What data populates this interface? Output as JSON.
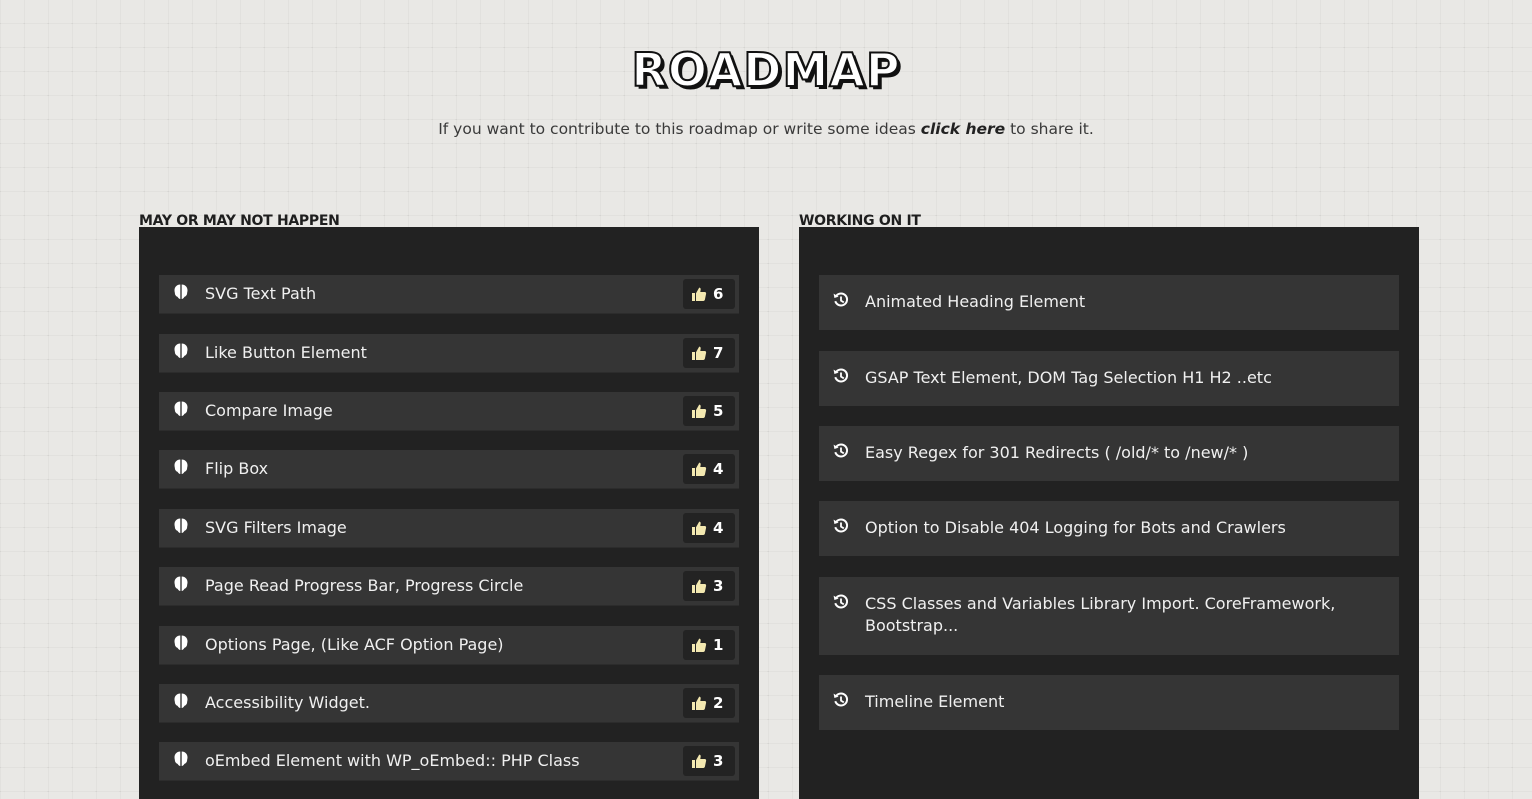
{
  "header": {
    "title": "ROADMAP",
    "subtitle_before": "If you want to contribute to this roadmap or write some ideas ",
    "subtitle_link": "click here",
    "subtitle_after": " to share it."
  },
  "columns": {
    "maybe": {
      "label": "MAY OR MAY NOT HAPPEN",
      "items": [
        {
          "label": "SVG Text Path",
          "votes": "6"
        },
        {
          "label": "Like Button Element",
          "votes": "7"
        },
        {
          "label": "Compare Image",
          "votes": "5"
        },
        {
          "label": "Flip Box",
          "votes": "4"
        },
        {
          "label": "SVG Filters Image",
          "votes": "4"
        },
        {
          "label": "Page Read Progress Bar, Progress Circle",
          "votes": "3"
        },
        {
          "label": "Options Page, (Like ACF Option Page)",
          "votes": "1"
        },
        {
          "label": "Accessibility Widget.",
          "votes": "2"
        },
        {
          "label": "oEmbed Element with WP_oEmbed:: PHP Class",
          "votes": "3"
        }
      ]
    },
    "working": {
      "label": "WORKING ON IT",
      "items": [
        {
          "label": "Animated Heading Element"
        },
        {
          "label": "GSAP Text Element, DOM Tag Selection H1 H2 ..etc"
        },
        {
          "label": "Easy Regex for 301 Redirects ( /old/* to /new/* )"
        },
        {
          "label": "Option to Disable 404 Logging for Bots and Crawlers"
        },
        {
          "label": "CSS Classes and Variables Library Import. CoreFramework, Bootstrap..."
        },
        {
          "label": "Timeline Element"
        }
      ]
    }
  },
  "colors": {
    "background": "#e9e8e5",
    "panel": "#222222",
    "card": "#353535",
    "text_light": "#f0f0f0"
  },
  "icons": {
    "idea": "brain-icon",
    "vote": "thumbs-up-icon",
    "in_progress": "history-icon"
  }
}
